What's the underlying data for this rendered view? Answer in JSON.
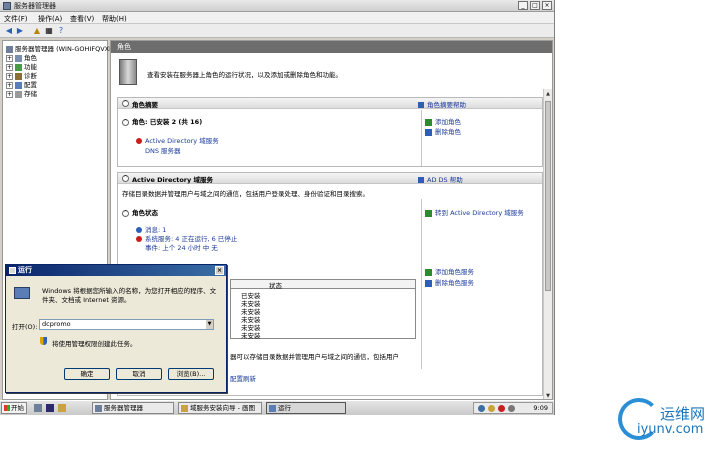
{
  "window": {
    "title": "服务器管理器"
  },
  "menu": [
    "文件(F)",
    "操作(A)",
    "查看(V)",
    "帮助(H)"
  ],
  "tree": [
    {
      "label": "服务器管理器 (WIN-GOHIFQVXKD)",
      "expander": "",
      "level": 0
    },
    {
      "label": "角色",
      "expander": "+",
      "level": 1
    },
    {
      "label": "功能",
      "expander": "+",
      "level": 1
    },
    {
      "label": "诊断",
      "expander": "+",
      "level": 1
    },
    {
      "label": "配置",
      "expander": "+",
      "level": 1
    },
    {
      "label": "存储",
      "expander": "+",
      "level": 1
    }
  ],
  "pane": {
    "header": "角色",
    "intro": "查看安装在服务器上角色的运行状况，以及添加或删除角色和功能。"
  },
  "roles_summary": {
    "title": "角色摘要",
    "help": "角色摘要帮助",
    "roles_heading": "角色: 已安装 2 (共 16)",
    "roles": [
      "Active Directory 域服务",
      "DNS 服务器"
    ],
    "actions": [
      "添加角色",
      "删除角色"
    ]
  },
  "ad_section": {
    "title": "Active Directory 域服务",
    "help": "AD DS 帮助",
    "description": "存储目录数据并管理用户与域之间的通信，包括用户登录处理、身份验证和目录搜索。",
    "status_heading": "角色状态",
    "goto": "转到 Active Directory 域服务",
    "messages": "消息: 1",
    "system_services": "系统服务: 4 正在运行, 6 已停止",
    "events": "事件: 上个 24 小时 中 无",
    "service_actions": [
      "添加角色服务",
      "删除角色服务"
    ],
    "table_header": "状态",
    "table_rows": [
      "已安装",
      "未安装",
      "未安装",
      "未安装",
      "未安装",
      "未安装"
    ],
    "description2": "器可以存储目录数据并管理用户与域之间的通信，包括用户",
    "refresh": "配置刷新"
  },
  "run_dialog": {
    "title": "运行",
    "description": "Windows 将根据您所输入的名称，为您打开相应的程序、文件夹、文档或 Internet 资源。",
    "open_label": "打开(O):",
    "open_value": "dcpromo",
    "admin_note": "将使用管理权限创建此任务。",
    "buttons": [
      "确定",
      "取消",
      "浏览(B)..."
    ]
  },
  "taskbar": {
    "start": "开始",
    "tasks": [
      "服务器管理器",
      "域服务安装向导 - 画图",
      "运行"
    ],
    "clock": "9:09"
  },
  "watermark": {
    "cn": "运维网",
    "en": "iyunv.com"
  },
  "colors": {
    "title_bar": "#0a246a",
    "link": "#1a3a9a",
    "error": "#c81e1e",
    "watermark": "#1b75bb"
  }
}
